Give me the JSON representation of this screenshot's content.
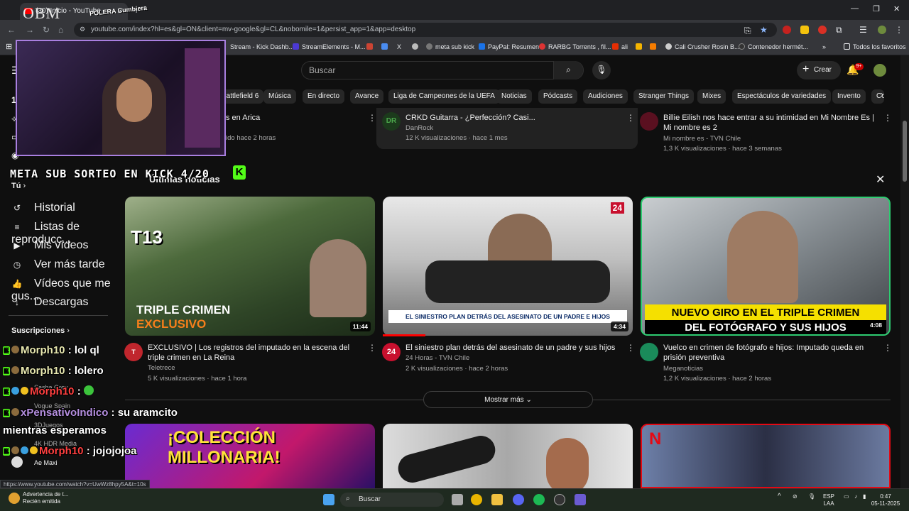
{
  "browser": {
    "tab_title": "(30) Inicio - YouTube",
    "url": "youtube.com/index?hl=es&gl=ON&client=mv-google&gl=CL&nobomile=1&persist_app=1&app=desktop",
    "bookmarks": [
      "Stream - Kick Dashb...",
      "StreamElements - M...",
      "meta sub kick",
      "PayPal: Resumen",
      "RARBG Torrents , fil...",
      "ali",
      "Cali Crusher Rosin B...",
      "Contenedor hermét...",
      "Todos los favoritos"
    ],
    "status_url": "https://www.youtube.com/watch?v=UwWz8hpy5A&t=10s"
  },
  "yt": {
    "search_placeholder": "Buscar",
    "create_label": "Crear",
    "bell_badge": "9+",
    "chips": [
      "Battlefield 6",
      "Música",
      "En directo",
      "Avance",
      "Liga de Campeones de la UEFA",
      "Noticias",
      "Pódcasts",
      "Audiciones",
      "Stranger Things",
      "Mixes",
      "Espectáculos de variedades",
      "Invento",
      "Co"
    ],
    "sidebar": {
      "you_heading": "Tú",
      "items": [
        "Historial",
        "Listas de reproducc...",
        "Mis vídeos",
        "Ver más tarde",
        "Vídeos que me gus...",
        "Descargas"
      ],
      "subs_heading": "Suscripciones",
      "subs": [
        "Sasha Grey",
        "Vogue Spain",
        "3DJuegos",
        "4K HDR Media",
        "Ae Maxi"
      ]
    },
    "top_row": [
      {
        "title": "s en Arica",
        "meta": "ido hace 2 horas"
      },
      {
        "title": "CRKD Guitarra - ¿Perfección? Casi...",
        "channel": "DanRock",
        "meta": "12 K visualizaciones · hace 1 mes"
      },
      {
        "title": "Billie Eilish nos hace entrar a su intimidad en Mi Nombre Es | Mi nombre es 2",
        "channel": "Mi nombre es - TVN Chile",
        "meta": "1,3 K visualizaciones · hace 3 semanas"
      }
    ],
    "shelf_title": "Últimas noticias",
    "videos": [
      {
        "title": "EXCLUSIVO | Los registros del imputado en la escena del triple crimen en La Reina",
        "channel": "Teletrece",
        "meta": "5 K visualizaciones · hace 1 hora",
        "duration": "11:44",
        "thumb_text1": "TRIPLE CRIMEN",
        "thumb_text2": "EXCLUSIVO",
        "thumb_logo": "T13"
      },
      {
        "title": "El siniestro plan detrás del asesinato de un padre y sus hijos",
        "channel": "24 Horas - TVN Chile",
        "meta": "2 K visualizaciones · hace 2 horas",
        "duration": "4:34",
        "thumb_text1": "EL SINIESTRO PLAN DETRÁS DEL ASESINATO DE UN PADRE E HIJOS",
        "thumb_logo": "24"
      },
      {
        "title": "Vuelco en crimen de fotógrafo e hijos: Imputado queda en prisión preventiva",
        "channel": "Meganoticias",
        "meta": "1,2 K visualizaciones · hace 2 horas",
        "duration": "4:08",
        "thumb_text1": "NUEVO GIRO EN EL TRIPLE CRIMEN",
        "thumb_text2": "DEL FOTÓGRAFO Y SUS HIJOS"
      }
    ],
    "show_more": "Mostrar más",
    "bottom_thumb_text": "¡COLECCIÓN MILLONARIA!"
  },
  "overlay": {
    "logo": "OBM",
    "polera": "POLERA Cumbiera",
    "meta_sub": "META SUB SORTEO EN KICK 4/20",
    "chat": [
      {
        "user": "Morph10",
        "msg": ": lol ql"
      },
      {
        "user": "Morph10",
        "msg": ": lolero"
      },
      {
        "user": "Morph10",
        "msg": ":"
      },
      {
        "user": "xPensativoIndico",
        "msg": ": su aramcito"
      },
      {
        "user": "",
        "msg": "mientras esperamos"
      },
      {
        "user": "Morph10",
        "msg": ": jojojojoa"
      }
    ]
  },
  "taskbar": {
    "notif_title": "Advertencia de t...",
    "notif_sub": "Recién emitida",
    "search": "Buscar",
    "lang": "ESP",
    "lang2": "LAA",
    "time": "0:47",
    "date": "05-11-2025"
  }
}
